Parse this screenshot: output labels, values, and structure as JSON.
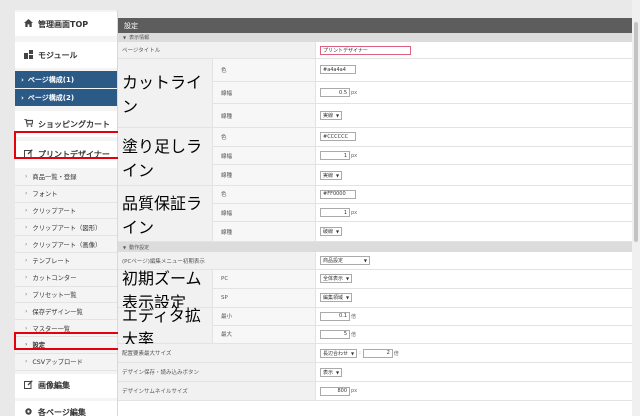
{
  "sidebar": {
    "admin_top": "管理画面TOP",
    "module": "モジュール",
    "page_config_1": "ページ構成(1)",
    "page_config_2": "ページ構成(2)",
    "shopping_cart": "ショッピングカート",
    "print_designer": "プリントデザイナー",
    "sub_items": [
      "商品一覧・登録",
      "フォント",
      "クリップアート",
      "クリップアート（図形）",
      "クリップアート（画像）",
      "テンプレート",
      "カットコンター",
      "プリセット一覧",
      "保存デザイン一覧",
      "マスター一覧",
      "設定",
      "CSVアップロード"
    ],
    "image_edit": "画像編集",
    "page_edit": "各ページ編集"
  },
  "main": {
    "header": "設定",
    "section_display": "表示情報",
    "section_operation": "動作設定",
    "page_title_label": "ページタイトル",
    "page_title_value": "プリントデザイナー",
    "cutline": {
      "label": "カットライン",
      "color_label": "色",
      "color_value": "#a4a4a4",
      "width_label": "線幅",
      "width_value": "0.5",
      "width_unit": "px",
      "type_label": "線種",
      "type_value": "実線"
    },
    "bleed": {
      "label": "塗り足しライン",
      "color_label": "色",
      "color_value": "#CCCCCC",
      "width_label": "線幅",
      "width_value": "1",
      "width_unit": "px",
      "type_label": "線種",
      "type_value": "実線"
    },
    "quality": {
      "label": "品質保証ライン",
      "color_label": "色",
      "color_value": "#FF0000",
      "width_label": "線幅",
      "width_value": "1",
      "width_unit": "px",
      "type_label": "線種",
      "type_value": "破線"
    },
    "pc_menu_label": "(PCページ)編集メニュー初期表示",
    "pc_menu_value": "商品設定",
    "zoom": {
      "label": "初期ズーム表示設定",
      "pc_label": "PC",
      "pc_value": "全体表示",
      "sp_label": "SP",
      "sp_value": "編集領域"
    },
    "editor_zoom": {
      "label": "エディタ拡大率",
      "min_label": "最小",
      "min_value": "0.1",
      "max_label": "最大",
      "max_value": "5",
      "unit": "倍"
    },
    "layout_size_label": "配置要素最大サイズ",
    "layout_size_select": "長辺合わせ",
    "layout_size_value": "2",
    "layout_size_unit": "倍",
    "save_btn_label": "デザイン保存・読み込みボタン",
    "save_btn_value": "表示",
    "thumb_size_label": "デザインサムネイルサイズ",
    "thumb_size_value": "800",
    "thumb_size_unit": "px"
  }
}
